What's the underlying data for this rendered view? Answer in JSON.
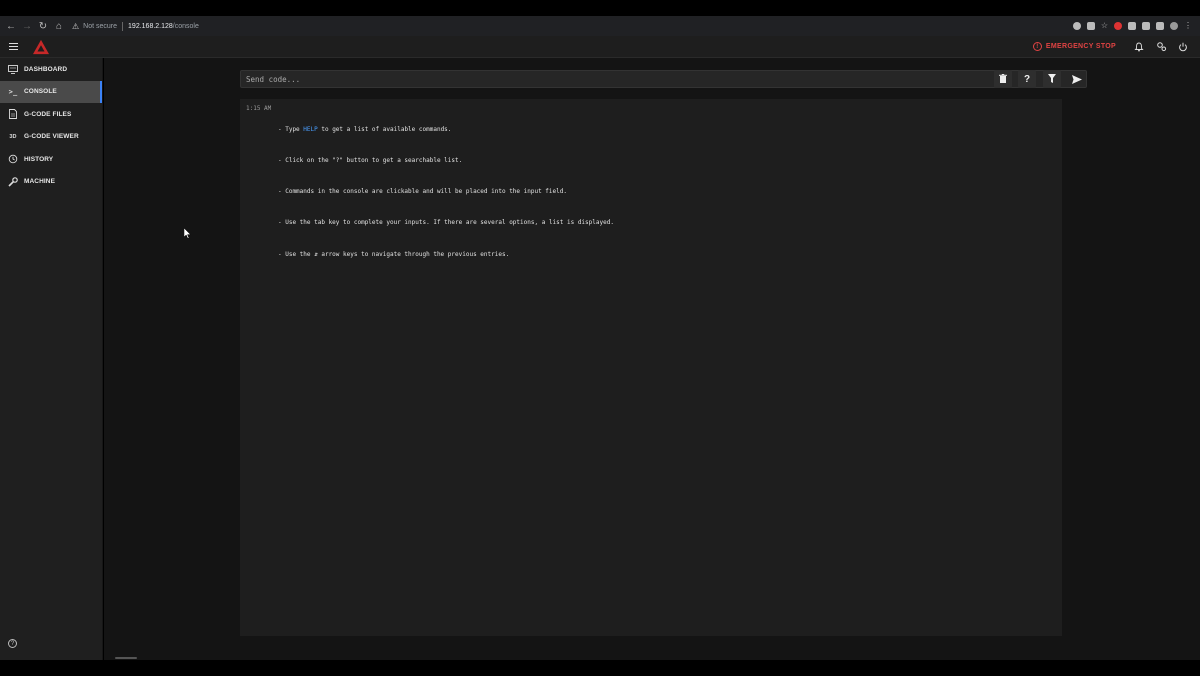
{
  "browser": {
    "security_label": "Not secure",
    "url_host": "192.168.2.128",
    "url_path": "/console"
  },
  "header": {
    "emergency_stop_label": "EMERGENCY STOP"
  },
  "sidebar": {
    "items": [
      {
        "label": "DASHBOARD",
        "icon": "monitor-icon"
      },
      {
        "label": "CONSOLE",
        "icon": "terminal-icon",
        "active": true
      },
      {
        "label": "G-CODE FILES",
        "icon": "file-icon"
      },
      {
        "label": "G-CODE VIEWER",
        "icon": "3d-icon",
        "icon_text": "3D"
      },
      {
        "label": "HISTORY",
        "icon": "history-icon"
      },
      {
        "label": "MACHINE",
        "icon": "wrench-icon"
      }
    ]
  },
  "console": {
    "input_placeholder": "Send code...",
    "entries": [
      {
        "time": "1:15 AM",
        "lines": [
          {
            "pre": "- Type ",
            "kw": "HELP",
            "post": " to get a list of available commands."
          },
          {
            "pre": "- Click on the \"?\" button to get a searchable list."
          },
          {
            "pre": "- Commands in the console are clickable and will be placed into the input field."
          },
          {
            "pre": "- Use the tab key to complete your inputs. If there are several options, a list is displayed."
          },
          {
            "pre": "- Use the ⇵ arrow keys to navigate through the previous entries."
          }
        ]
      }
    ]
  },
  "colors": {
    "accent": "#3b82f6",
    "emergency": "#e04343",
    "keyword": "#4a9eff",
    "logo": "#c62828"
  }
}
